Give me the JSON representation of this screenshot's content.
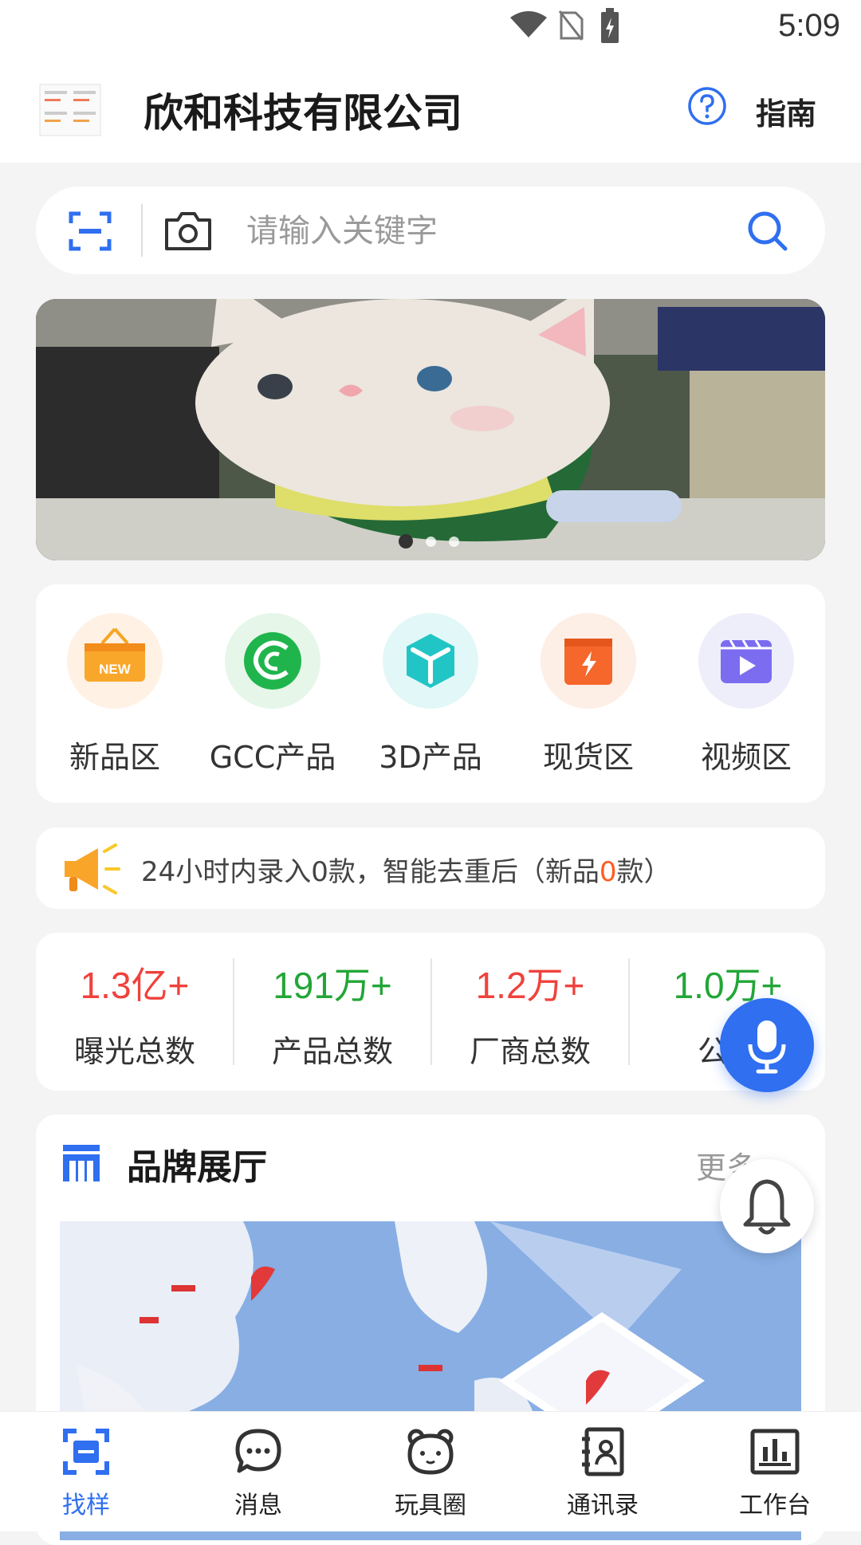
{
  "status_bar": {
    "time": "5:09"
  },
  "header": {
    "company_name": "欣和科技有限公司",
    "guide_label": "指南"
  },
  "search": {
    "placeholder": "请输入关键字"
  },
  "banner": {
    "slide_count": 3,
    "active_slide": 1
  },
  "categories": [
    {
      "label": "新品区",
      "icon": "new-tag-icon",
      "bg": "#fff1e4"
    },
    {
      "label": "GCC产品",
      "icon": "gcc-logo-icon",
      "bg": "#e6f6e9"
    },
    {
      "label": "3D产品",
      "icon": "cube-icon",
      "bg": "#e2f7f7"
    },
    {
      "label": "现货区",
      "icon": "box-bolt-icon",
      "bg": "#fdeee6"
    },
    {
      "label": "视频区",
      "icon": "video-clapper-icon",
      "bg": "#eeeefb"
    }
  ],
  "notice": {
    "prefix": "24小时内录入0款，智能去重后（新品",
    "highlight": "0",
    "suffix": "款）"
  },
  "stats": [
    {
      "value": "1.3亿+",
      "label": "曝光总数",
      "color": "#f0423c"
    },
    {
      "value": "191万+",
      "label": "产品总数",
      "color": "#22a637"
    },
    {
      "value": "1.2万+",
      "label": "厂商总数",
      "color": "#f0423c"
    },
    {
      "value": "1.0万+",
      "label": "公司",
      "color": "#22a637"
    }
  ],
  "brand_hall": {
    "title": "品牌展厅",
    "more": "更多"
  },
  "bottom_nav": [
    {
      "label": "找样",
      "icon": "scan-frame-icon",
      "active": true
    },
    {
      "label": "消息",
      "icon": "chat-bubble-icon",
      "active": false
    },
    {
      "label": "玩具圈",
      "icon": "bear-face-icon",
      "active": false
    },
    {
      "label": "通讯录",
      "icon": "contacts-book-icon",
      "active": false
    },
    {
      "label": "工作台",
      "icon": "bar-chart-board-icon",
      "active": false
    }
  ],
  "colors": {
    "accent": "#2f6ff0",
    "highlight": "#ff5a1f"
  }
}
